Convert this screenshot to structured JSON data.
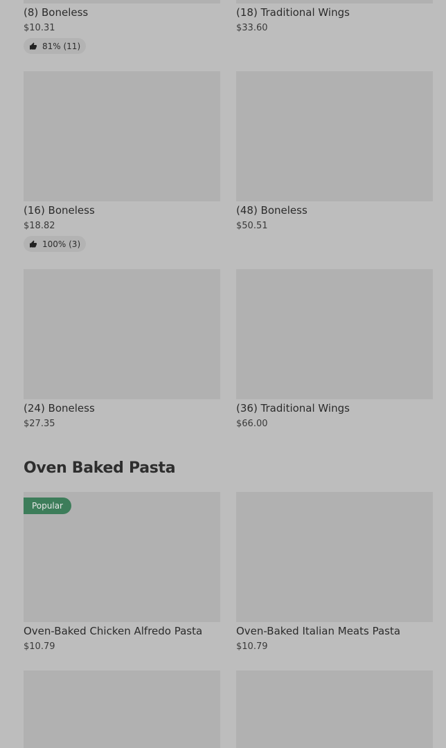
{
  "rows": [
    {
      "items": [
        {
          "name": "(8) Boneless",
          "price": "$10.31",
          "rating": "81% (11)"
        },
        {
          "name": "(18) Traditional Wings",
          "price": "$33.60",
          "rating": ""
        }
      ]
    },
    {
      "items": [
        {
          "name": "(16) Boneless",
          "price": "$18.82",
          "rating": "100% (3)"
        },
        {
          "name": "(48) Boneless",
          "price": "$50.51",
          "rating": ""
        }
      ]
    },
    {
      "items": [
        {
          "name": "(24) Boneless",
          "price": "$27.35",
          "rating": ""
        },
        {
          "name": "(36) Traditional Wings",
          "price": "$66.00",
          "rating": ""
        }
      ]
    }
  ],
  "section_pasta": {
    "title": "Oven Baked Pasta",
    "items": [
      {
        "name": "Oven-Baked Chicken Alfredo Pasta",
        "price": "$10.79",
        "badge": "Popular"
      },
      {
        "name": "Oven-Baked Italian Meats Pasta",
        "price": "$10.79",
        "badge": ""
      }
    ]
  },
  "icons": {
    "rating": "thumbs-up-icon"
  },
  "colors": {
    "badge": "#3d7d5a",
    "placeholder": "#b1b1b1",
    "background": "#bdbdbd"
  }
}
